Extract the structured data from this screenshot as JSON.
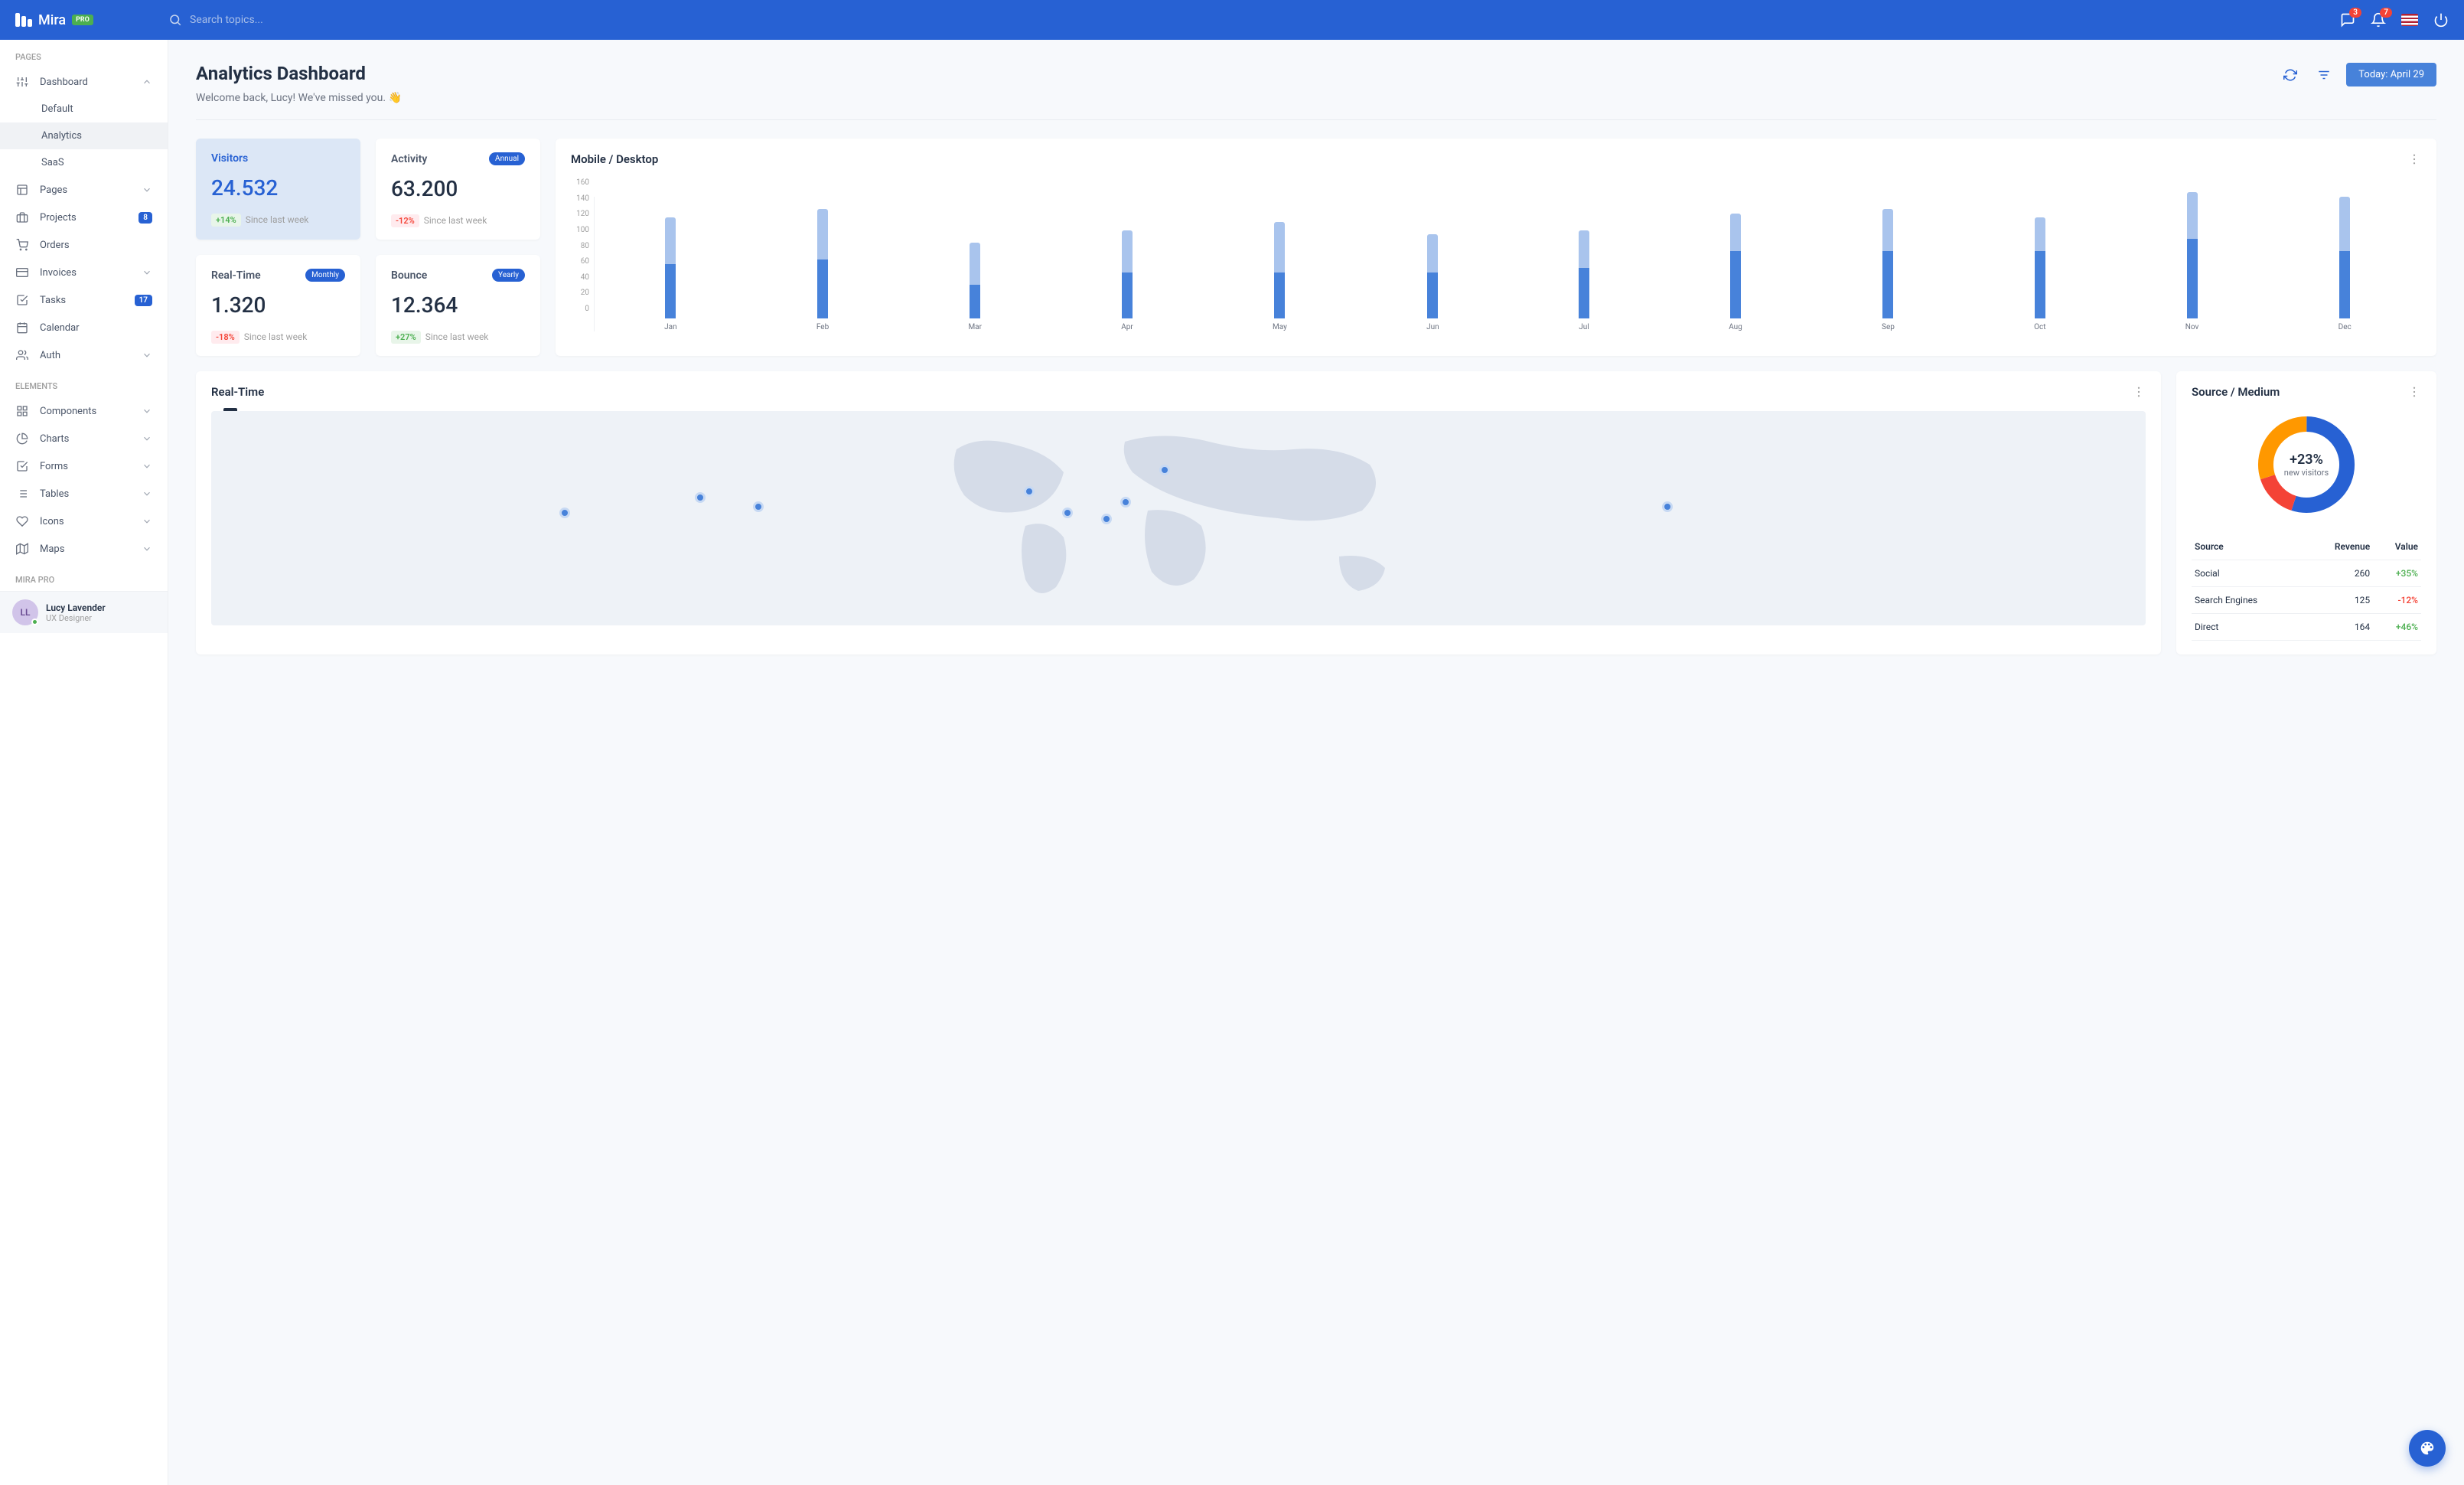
{
  "brand": {
    "name": "Mira",
    "badge": "PRO"
  },
  "search": {
    "placeholder": "Search topics..."
  },
  "topbar": {
    "messages_badge": "3",
    "notifications_badge": "7"
  },
  "sidebar": {
    "section_pages": "PAGES",
    "section_elements": "ELEMENTS",
    "section_pro": "MIRA PRO",
    "dashboard": {
      "label": "Dashboard",
      "sub": {
        "default": "Default",
        "analytics": "Analytics",
        "saas": "SaaS"
      }
    },
    "pages": "Pages",
    "projects": {
      "label": "Projects",
      "badge": "8"
    },
    "orders": "Orders",
    "invoices": "Invoices",
    "tasks": {
      "label": "Tasks",
      "badge": "17"
    },
    "calendar": "Calendar",
    "auth": "Auth",
    "components": "Components",
    "charts": "Charts",
    "forms": "Forms",
    "tables": "Tables",
    "icons": "Icons",
    "maps": "Maps",
    "user": {
      "name": "Lucy Lavender",
      "role": "UX Designer"
    }
  },
  "page": {
    "title": "Analytics Dashboard",
    "subtitle": "Welcome back, Lucy! We've missed you. 👋",
    "date_button": "Today: April 29"
  },
  "stats": {
    "visitors": {
      "title": "Visitors",
      "value": "24.532",
      "pct": "+14%",
      "sub": "Since last week"
    },
    "activity": {
      "title": "Activity",
      "chip": "Annual",
      "value": "63.200",
      "pct": "-12%",
      "sub": "Since last week"
    },
    "realtime": {
      "title": "Real-Time",
      "chip": "Monthly",
      "value": "1.320",
      "pct": "-18%",
      "sub": "Since last week"
    },
    "bounce": {
      "title": "Bounce",
      "chip": "Yearly",
      "value": "12.364",
      "pct": "+27%",
      "sub": "Since last week"
    }
  },
  "mobile_desktop": {
    "title": "Mobile / Desktop"
  },
  "realtime_map": {
    "title": "Real-Time"
  },
  "source_medium": {
    "title": "Source / Medium",
    "center_pct": "+23%",
    "center_sub": "new visitors",
    "headers": {
      "source": "Source",
      "revenue": "Revenue",
      "value": "Value"
    },
    "rows": [
      {
        "source": "Social",
        "revenue": "260",
        "value": "+35%",
        "dir": "up"
      },
      {
        "source": "Search Engines",
        "revenue": "125",
        "value": "-12%",
        "dir": "down"
      },
      {
        "source": "Direct",
        "revenue": "164",
        "value": "+46%",
        "dir": "up"
      }
    ]
  },
  "chart_data": [
    {
      "type": "bar",
      "title": "Mobile / Desktop",
      "categories": [
        "Jan",
        "Feb",
        "Mar",
        "Apr",
        "May",
        "Jun",
        "Jul",
        "Aug",
        "Sep",
        "Oct",
        "Nov",
        "Dec"
      ],
      "series": [
        {
          "name": "Mobile",
          "values": [
            65,
            70,
            40,
            55,
            55,
            55,
            60,
            80,
            80,
            80,
            95,
            80
          ]
        },
        {
          "name": "Desktop",
          "values": [
            120,
            130,
            90,
            105,
            115,
            100,
            105,
            125,
            130,
            120,
            150,
            145
          ]
        }
      ],
      "ylabel": "",
      "xlabel": "",
      "ylim": [
        0,
        160
      ],
      "y_ticks": [
        0,
        20,
        40,
        60,
        80,
        100,
        120,
        140,
        160
      ]
    },
    {
      "type": "pie",
      "title": "Source / Medium",
      "series": [
        {
          "name": "Blue",
          "value": 55,
          "color": "#2761d3"
        },
        {
          "name": "Red",
          "value": 15,
          "color": "#f44336"
        },
        {
          "name": "Orange",
          "value": 30,
          "color": "#ff9800"
        }
      ]
    }
  ]
}
